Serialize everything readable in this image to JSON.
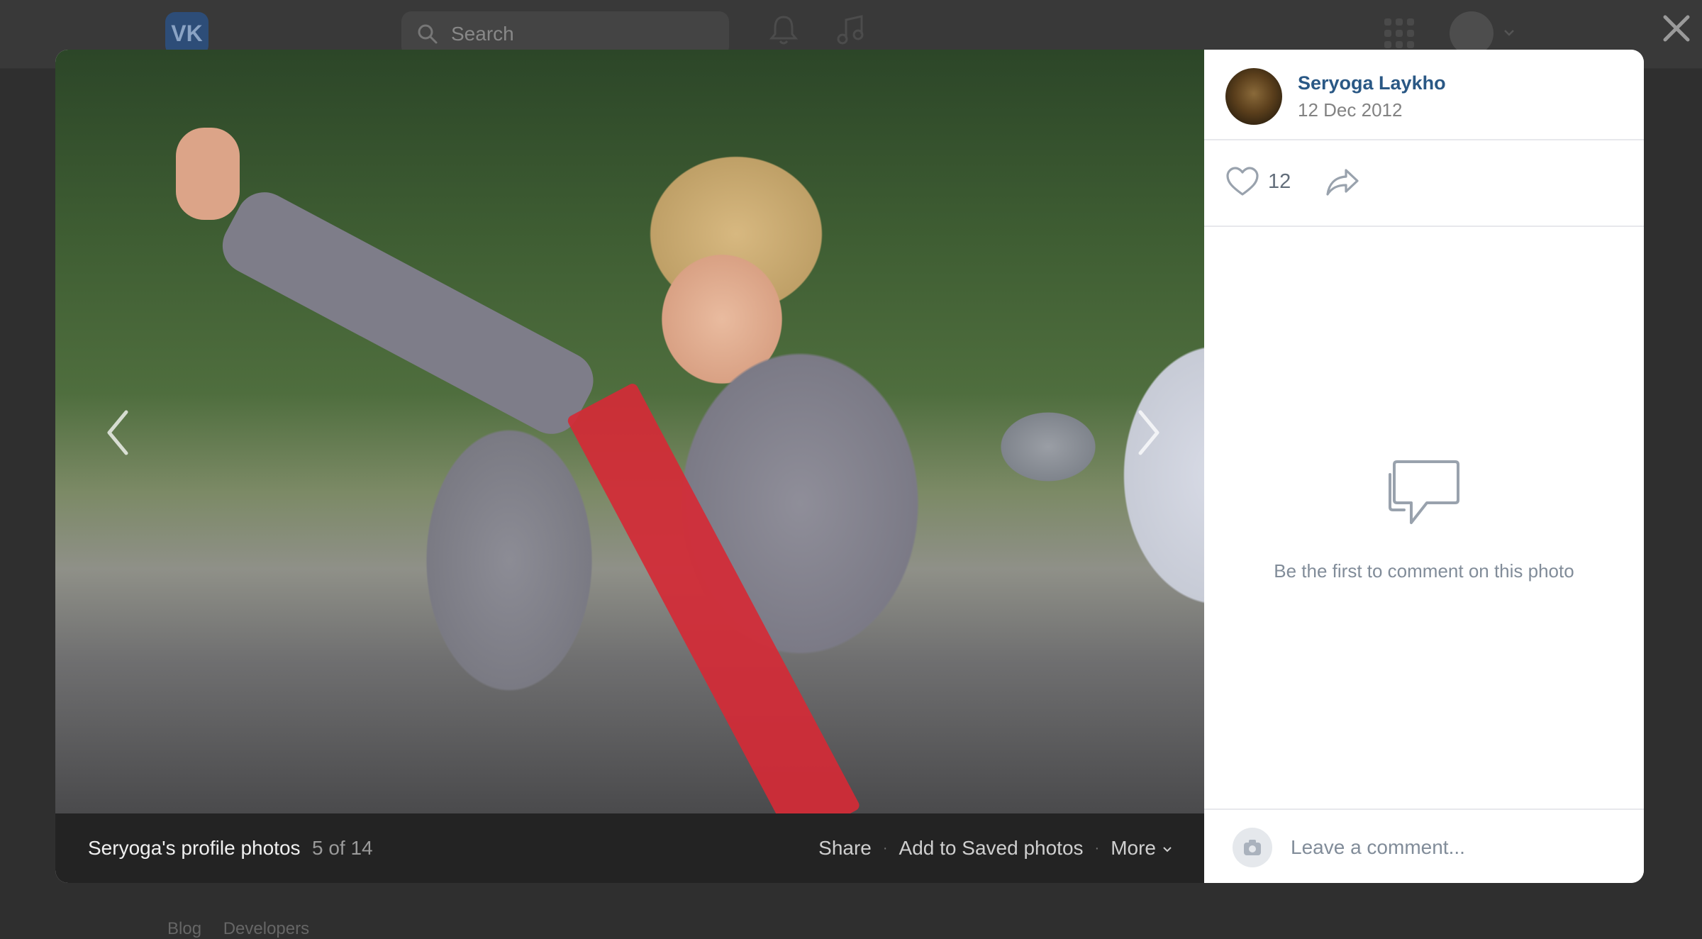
{
  "header": {
    "logo_text": "VK",
    "search": {
      "placeholder": "Search"
    }
  },
  "footer": {
    "links": [
      "Blog",
      "Developers"
    ]
  },
  "viewer": {
    "album_title": "Seryoga's profile photos",
    "position": "5 of 14",
    "actions": {
      "share": "Share",
      "save": "Add to Saved photos",
      "more": "More"
    },
    "author": {
      "name": "Seryoga Laykho",
      "date": "12 Dec 2012"
    },
    "likes": {
      "count": "12"
    },
    "comments": {
      "empty_text": "Be the first to comment on this photo",
      "placeholder": "Leave a comment..."
    }
  },
  "icons": [
    "search-icon",
    "bell-icon",
    "music-icon",
    "apps-icon",
    "close-icon",
    "chevron-left-icon",
    "chevron-right-icon",
    "heart-icon",
    "share-icon",
    "comment-icon",
    "camera-icon",
    "chevron-down-icon"
  ],
  "colors": {
    "link": "#2a5885",
    "muted": "#818c99",
    "overlay": "#2f2f2f"
  }
}
